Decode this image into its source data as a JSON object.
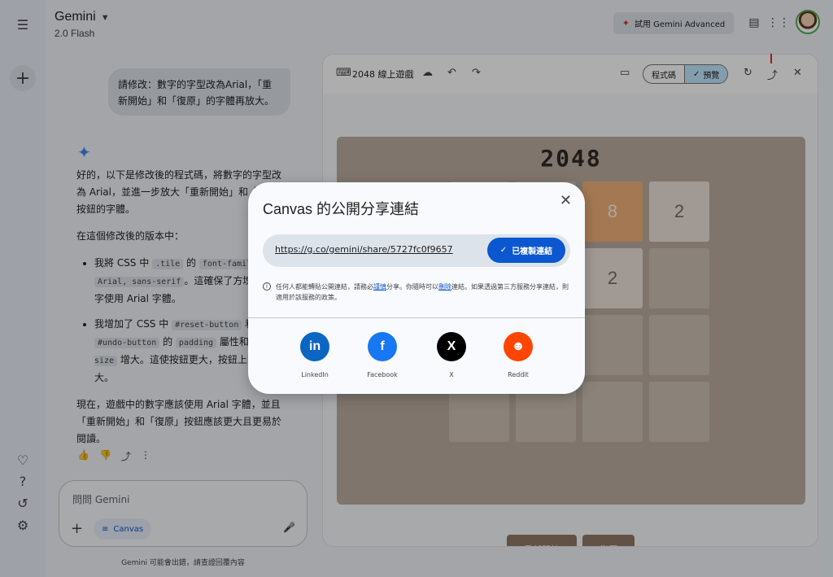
{
  "app": {
    "title": "Gemini",
    "model": "2.0 Flash",
    "advanced_label": "試用 Gemini Advanced"
  },
  "chat": {
    "user_message": "請修改：數字的字型改為Arial，「重新開始」和「復原」的字體再放大。",
    "reply_intro": "好的，以下是修改後的程式碼，將數字的字型改為 Arial，並進一步放大「重新開始」和「復原」按鈕的字體。",
    "list_heading": "在這個修改後的版本中：",
    "bullet1_a": "我將 CSS 中",
    "bullet1_code1": ".tile",
    "bullet1_b": "的",
    "bullet1_code2": "font-family",
    "bullet1_c": "設為",
    "bullet1_code3": "Arial, sans-serif",
    "bullet1_d": "。這確保了方塊中的數字使用 Arial 字體。",
    "bullet2_a": "我增加了 CSS 中",
    "bullet2_code1": "#reset-button",
    "bullet2_b": "和",
    "bullet2_code2": "#undo-button",
    "bullet2_c": "的",
    "bullet2_code3": "padding",
    "bullet2_d": "屬性和",
    "bullet2_code4": "font-size",
    "bullet2_e": "增大。這使按鈕更大，按鈕上的文字更大。",
    "conclusion": "現在，遊戲中的數字應該使用 Arial 字體，並且「重新開始」和「復原」按鈕應該更大且更易於閱讀。",
    "prompt_placeholder": "問問 Gemini",
    "canvas_chip": "Canvas",
    "disclaimer": "Gemini 可能會出錯，請查證回覆內容"
  },
  "panel": {
    "title": "2048 線上遊戲",
    "code_tab": "程式碼",
    "preview_tab": "預覽",
    "game_title": "2048",
    "tiles": [
      [
        "",
        "",
        "8",
        "2"
      ],
      [
        "",
        "",
        "2",
        ""
      ],
      [
        "",
        "",
        "",
        ""
      ],
      [
        "",
        "",
        "",
        ""
      ]
    ],
    "reset_label": "重新開始",
    "undo_label": "復原"
  },
  "dialog": {
    "title": "Canvas 的公開分享連結",
    "link": "https://g.co/gemini/share/5727fc0f9657",
    "copied_label": "已複製連結",
    "info_a": "任何人都能轉貼公開連結，請務必",
    "info_link1": "謹慎",
    "info_b": "分享。你隨時可以",
    "info_link2": "刪除",
    "info_c": "連結。如果透過第三方服務分享連結，則適用於該服務的政策。",
    "share_targets": [
      {
        "label": "LinkedIn",
        "color": "#0a66c2",
        "glyph": "in"
      },
      {
        "label": "Facebook",
        "color": "#1877f2",
        "glyph": "f"
      },
      {
        "label": "X",
        "color": "#000000",
        "glyph": "X"
      },
      {
        "label": "Reddit",
        "color": "#ff4500",
        "glyph": "☻"
      }
    ]
  },
  "icons": [
    "menu-icon",
    "new-chat-icon",
    "gem-icon",
    "help-icon",
    "history-icon",
    "settings-icon",
    "archive-icon",
    "apps-icon",
    "share-icon",
    "close-icon",
    "undo-icon",
    "redo-icon",
    "cloud-icon",
    "refresh-icon",
    "console-icon",
    "mic-icon",
    "info-icon",
    "check-icon"
  ]
}
